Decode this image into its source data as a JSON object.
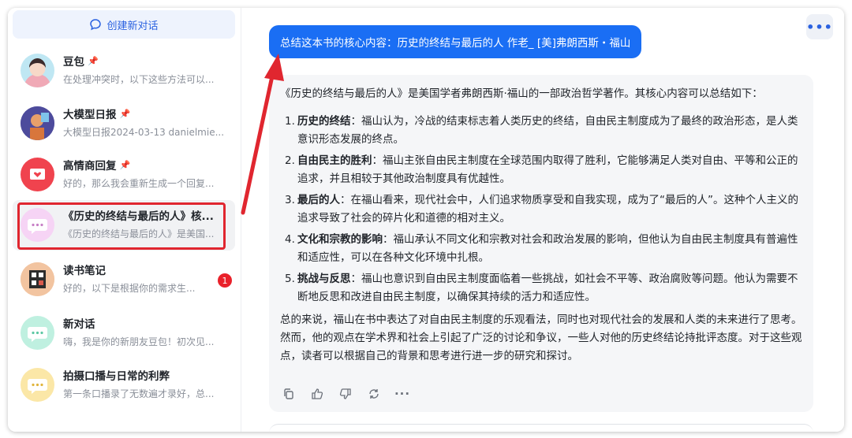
{
  "sidebar": {
    "new_chat_label": "创建新对话",
    "conversations": [
      {
        "title": "豆包",
        "snippet": "在处理冲突时，以下这些方法可以...",
        "pinned": true
      },
      {
        "title": "大模型日报",
        "snippet": "大模型日报2024-03-13 danielmie...",
        "pinned": true
      },
      {
        "title": "高情商回复",
        "snippet": "好的，那么我会重新生成一个回复...",
        "pinned": true
      },
      {
        "title": "《历史的终结与最后的人》核...",
        "snippet": "《历史的终结与最后的人》是美国...",
        "pinned": false
      },
      {
        "title": "读书笔记",
        "snippet": "好的，以下是根据你的需求生...",
        "pinned": false,
        "badge": "1"
      },
      {
        "title": "新对话",
        "snippet": "嗨，我是你的新朋友豆包！初次见...",
        "pinned": false
      },
      {
        "title": "拍摄口播与日常的利弊",
        "snippet": "第一条口播录了无数遍才录好，总...",
        "pinned": false
      }
    ]
  },
  "chat": {
    "user_message": "总结这本书的核心内容：历史的终结与最后的人 作老_ [美]弗朗西斯・福山",
    "reply_intro": "《历史的终结与最后的人》是美国学者弗朗西斯·福山的一部政治哲学著作。其核心内容可以总结如下：",
    "points": [
      {
        "num": "1.",
        "head": "历史的终结",
        "text": "：福山认为，冷战的结束标志着人类历史的终结，自由民主制度成为了最终的政治形态，是人类意识形态发展的终点。"
      },
      {
        "num": "2.",
        "head": "自由民主的胜利",
        "text": "：福山主张自由民主制度在全球范围内取得了胜利，它能够满足人类对自由、平等和公正的追求，并且相较于其他政治制度具有优越性。"
      },
      {
        "num": "3.",
        "head": "最后的人",
        "text": "：在福山看来，现代社会中，人们追求物质享受和自我实现，成为了“最后的人”。这种个人主义的追求导致了社会的碎片化和道德的相对主义。"
      },
      {
        "num": "4.",
        "head": "文化和宗教的影响",
        "text": "：福山承认不同文化和宗教对社会和政治发展的影响，但他认为自由民主制度具有普遍性和适应性，可以在各种文化环境中扎根。"
      },
      {
        "num": "5.",
        "head": "挑战与反思",
        "text": "：福山也意识到自由民主制度面临着一些挑战，如社会不平等、政治腐败等问题。他认为需要不断地反思和改进自由民主制度，以确保其持续的活力和适应性。"
      }
    ],
    "summary": "总的来说，福山在书中表达了对自由民主制度的乐观看法，同时也对现代社会的发展和人类的未来进行了思考。然而，他的观点在学术界和社会上引起了广泛的讨论和争议，一些人对他的历史终结论持批评态度。对于这些观点，读者可以根据自己的背景和思考进行进一步的研究和探讨。"
  },
  "colors": {
    "accent": "#1a6ef4",
    "annotation_red": "#e0262f",
    "badge": "#e9212a"
  }
}
